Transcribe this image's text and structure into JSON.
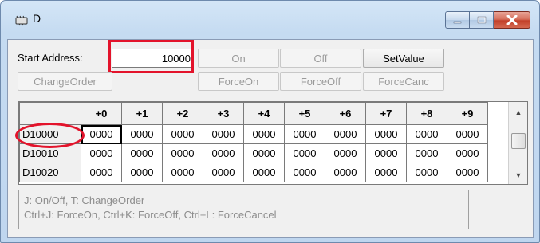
{
  "window": {
    "title": "D"
  },
  "toolbar": {
    "start_address_label": "Start Address:",
    "start_address_value": "10000",
    "on_label": "On",
    "off_label": "Off",
    "setvalue_label": "SetValue",
    "changeorder_label": "ChangeOrder",
    "forceon_label": "ForceOn",
    "forceoff_label": "ForceOff",
    "forcecanc_label": "ForceCanc"
  },
  "grid": {
    "columns": [
      "+0",
      "+1",
      "+2",
      "+3",
      "+4",
      "+5",
      "+6",
      "+7",
      "+8",
      "+9"
    ],
    "rows": [
      {
        "address": "D10000",
        "values": [
          "0000",
          "0000",
          "0000",
          "0000",
          "0000",
          "0000",
          "0000",
          "0000",
          "0000",
          "0000"
        ]
      },
      {
        "address": "D10010",
        "values": [
          "0000",
          "0000",
          "0000",
          "0000",
          "0000",
          "0000",
          "0000",
          "0000",
          "0000",
          "0000"
        ]
      },
      {
        "address": "D10020",
        "values": [
          "0000",
          "0000",
          "0000",
          "0000",
          "0000",
          "0000",
          "0000",
          "0000",
          "0000",
          "0000"
        ]
      }
    ],
    "selected_cell": {
      "row": 0,
      "col": 0
    }
  },
  "hints": {
    "line1": "J: On/Off,   T: ChangeOrder",
    "line2": "Ctrl+J: ForceOn,   Ctrl+K: ForceOff,   Ctrl+L: ForceCancel"
  },
  "icons": {
    "app": "chip-icon",
    "minimize": "minimize-icon",
    "maximize": "maximize-icon",
    "close": "close-icon",
    "scroll_up": "scroll-up-arrow-icon",
    "scroll_down": "scroll-down-arrow-icon"
  },
  "colors": {
    "highlight": "#e3132b",
    "close_button": "#c2402a"
  }
}
